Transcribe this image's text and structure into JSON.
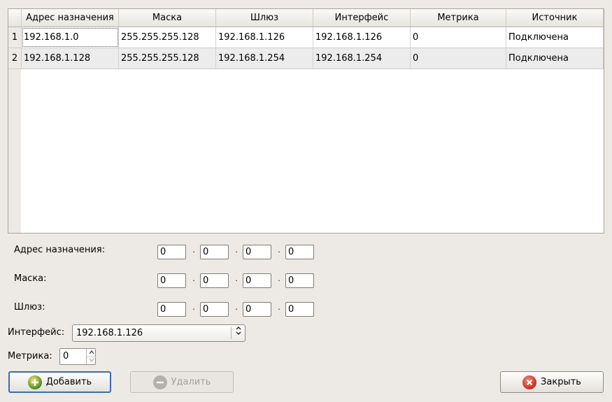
{
  "table": {
    "columns": [
      "Адрес назначения",
      "Маска",
      "Шлюз",
      "Интерфейс",
      "Метрика",
      "Источник"
    ],
    "rows": [
      {
        "num": "1",
        "cells": [
          "192.168.1.0",
          "255.255.255.128",
          "192.168.1.126",
          "192.168.1.126",
          "0",
          "Подключена"
        ]
      },
      {
        "num": "2",
        "cells": [
          "192.168.1.128",
          "255.255.255.128",
          "192.168.1.254",
          "192.168.1.254",
          "0",
          "Подключена"
        ]
      }
    ]
  },
  "form": {
    "dest_label": "Адрес назначения:",
    "mask_label": "Маска:",
    "gateway_label": "Шлюз:",
    "dest_octets": [
      "0",
      "0",
      "0",
      "0"
    ],
    "mask_octets": [
      "0",
      "0",
      "0",
      "0"
    ],
    "gateway_octets": [
      "0",
      "0",
      "0",
      "0"
    ],
    "separator": "·",
    "interface_label": "Интерфейс:",
    "interface_value": "192.168.1.126",
    "metric_label": "Метрика:",
    "metric_value": "0"
  },
  "buttons": {
    "add_label": "Добавить",
    "delete_label": "Удалить",
    "close_label": "Закрыть"
  },
  "icons": {
    "add": "add-icon",
    "delete": "remove-icon",
    "close": "close-icon"
  },
  "colors": {
    "default_border": "#3d6bab",
    "add_icon": "#4a8a2a",
    "close_icon": "#cc2a1a"
  }
}
